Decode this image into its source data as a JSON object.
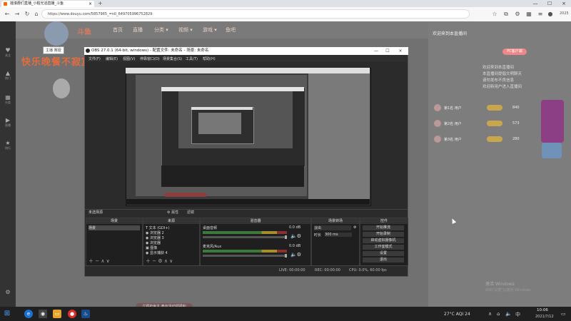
{
  "browser": {
    "tab_title": "摇滚爵们直播_小柏光滔直播_斗鱼",
    "tab_close": "×",
    "new_tab": "+",
    "url": "https://www.douyu.com/5857965_=n0_649705996752829",
    "minimize": "—",
    "maximize": "☐",
    "close": "×",
    "counter": "2025"
  },
  "douyu": {
    "logo": "斗鱼",
    "nav": [
      "首页",
      "直播",
      "分类 ▾",
      "视频 ▾",
      "游戏 ▾",
      "鱼吧"
    ],
    "anchor_label": "主播 赛娅",
    "slogan": "快乐晚餐不寂寞",
    "left_bar": [
      "关注",
      "热门",
      "分类",
      "直播",
      "排行"
    ],
    "right_panel_top": "欢迎来到本直播间",
    "right_btn": "PC客户端",
    "messages": [
      "欢迎来到本直播间",
      "本直播间提倡文明聊天",
      "请勿发布不良信息",
      "欢迎新用户进入直播间"
    ],
    "rank_rows": [
      {
        "name": "第1名 用户",
        "num": "840"
      },
      {
        "name": "第2名 用户",
        "num": "573"
      },
      {
        "name": "第3名 用户",
        "num": "280"
      }
    ],
    "gift_bar": "立即抢鱼丸 参与活动领福利",
    "watermark1": "激活 Windows",
    "watermark2": "转到\"设置\"以激活 Windows。"
  },
  "obs": {
    "title": "OBS 27.0.1 (64-bit, windows) - 配置文件: 未命名 - 场景: 未命名",
    "menu": [
      "文件(F)",
      "编辑(E)",
      "视图(V)",
      "停靠窗口(D)",
      "场景集合(S)",
      "工具(T)",
      "帮助(H)"
    ],
    "current_scene": "未选择源",
    "props_btn": "⚙ 属性",
    "filter_btn": "滤镜",
    "docks": {
      "scenes": {
        "head": "场景",
        "items": [
          "场景"
        ]
      },
      "sources": {
        "head": "来源",
        "items": [
          "T 文本 (GDI+)",
          "◉ 浏览器 2",
          "◉ 浏览器 3",
          "◉ 浏览器",
          "▣ 图像",
          "◉ 显示捕获 4"
        ]
      },
      "mixer": {
        "head": "混音器",
        "track1": "桌面音频",
        "track1_db": "0.0 dB",
        "track2": "麦克风/Aux",
        "track2_db": "0.0 dB"
      },
      "transitions": {
        "head": "场景转场",
        "type": "淡出",
        "duration_label": "时长",
        "duration": "300 ms"
      },
      "controls": {
        "head": "控件",
        "buttons": [
          "开始推流",
          "开始录制",
          "启动虚拟摄像机",
          "工作室模式",
          "设置",
          "退出"
        ]
      }
    },
    "status": {
      "live": "LIVE: 00:00:00",
      "rec": "REC: 00:00:00",
      "cpu": "CPU: 0.0%, 60.00 fps"
    }
  },
  "taskbar": {
    "weather": "27°C AQI 24",
    "time": "10:06",
    "date": "2021/7/12",
    "start": "⊞"
  }
}
